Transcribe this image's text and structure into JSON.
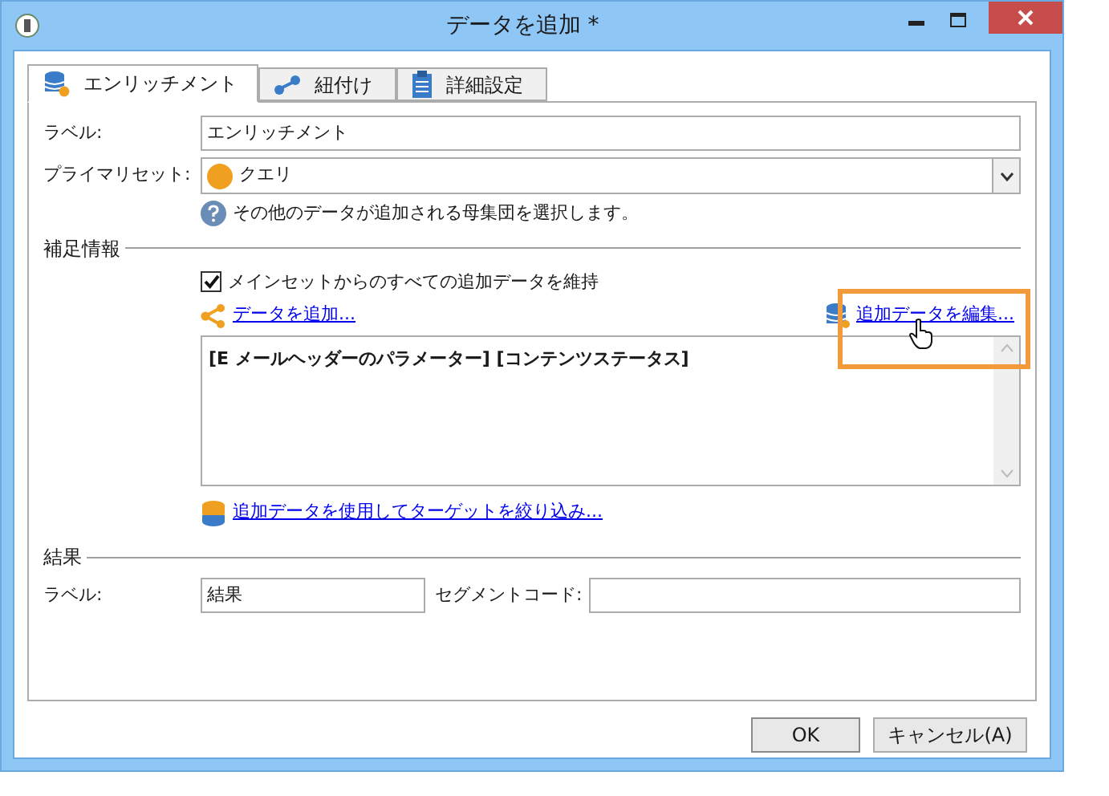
{
  "window": {
    "title": "データを追加 *"
  },
  "tabs": [
    {
      "label": "エンリッチメント",
      "selected": true
    },
    {
      "label": "紐付け",
      "selected": false
    },
    {
      "label": "詳細設定",
      "selected": false
    }
  ],
  "label_field": {
    "label": "ラベル:",
    "value": "エンリッチメント"
  },
  "primary_set": {
    "label": "プライマリセット:",
    "value": "クエリ",
    "hint": "その他のデータが追加される母集団を選択します。"
  },
  "supplement": {
    "heading": "補足情報",
    "keep_checkbox": {
      "label": "メインセットからのすべての追加データを維持",
      "checked": true
    },
    "add_link": "データを追加...",
    "edit_link": "追加データを編集...",
    "edit_link_highlighted": true,
    "list_text": "[E メールヘッダーのパラメーター] [コンテンツステータス]",
    "filter_link": "追加データを使用してターゲットを絞り込み..."
  },
  "result": {
    "heading": "結果",
    "label": "ラベル:",
    "value": "結果",
    "segment_label": "セグメントコード:"
  },
  "buttons": [
    {
      "label": "OK",
      "kind": "primary"
    },
    {
      "label": "キャンセル(A)",
      "kind": "normal"
    }
  ]
}
